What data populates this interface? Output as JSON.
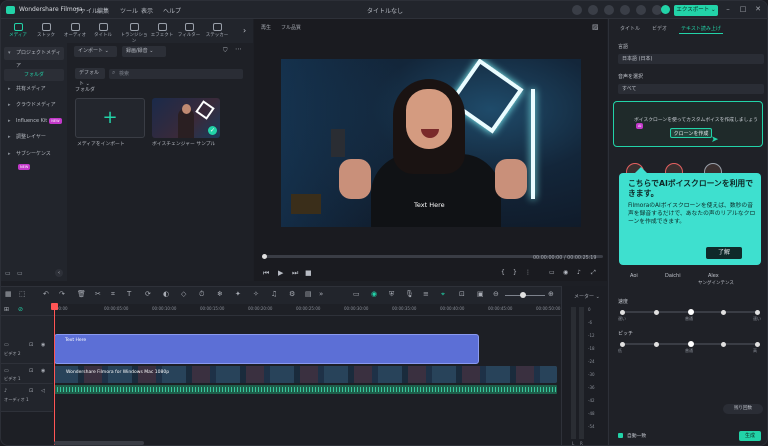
{
  "titlebar": {
    "app_name": "Wondershare Filmora",
    "menu": [
      "ファイル",
      "編集",
      "ツール",
      "表示",
      "ヘルプ"
    ],
    "document_title": "タイトルなし",
    "export_label": "エクスポート ⌄"
  },
  "media_toolbar": {
    "tabs": [
      "メディア",
      "ストック",
      "オーディオ",
      "タイトル",
      "トランジション",
      "エフェクト",
      "フィルター",
      "ステッカー"
    ],
    "active_tab": 0
  },
  "left_nav": {
    "items": [
      {
        "label": "プロジェクトメディア",
        "expanded": true
      },
      {
        "label": "フォルダ",
        "selected": true
      },
      {
        "label": "共有メディア"
      },
      {
        "label": "クラウドメディア"
      },
      {
        "label": "Influence Kit",
        "badge": "NEW"
      },
      {
        "label": "調整レイヤー"
      },
      {
        "label": "サブシーケンス",
        "badge": "NEW"
      }
    ]
  },
  "media": {
    "import_label": "インポート ⌄",
    "record_label": "録画/録音 ⌄",
    "sort_label": "デフォルト ⌄",
    "search_placeholder": "検索",
    "folder_label": "フォルダ",
    "import_card_label": "メディアをインポート",
    "sample_label": "ボイスチェンジャー サンプル"
  },
  "preview": {
    "player_label": "再生",
    "quality_label": "フル品質",
    "video_overlay_text": "Text Here",
    "current_time": "00:00:00:00",
    "total_time": "/ 00:00:25:19"
  },
  "right_panel": {
    "tabs": [
      "タイトル",
      "ビデオ",
      "テキスト読み上げ"
    ],
    "active_tab": 2,
    "language_label": "言語",
    "language_value": "日本語 (日本)",
    "voice_select_label": "音声を選択",
    "voice_filter": "すべて",
    "clone_prompt": "ボイスクローンを使ってカスタムボイスを作成しましょう",
    "clone_badge": "AI",
    "clone_button": "クローンを作成",
    "tooltip_title": "こちらでAIボイスクローンを利用できます。",
    "tooltip_body": "FilmoraのAIボイスクローンを使えば、数秒の音声を録音するだけで、あなたの声のリアルなクローンを作成できます。",
    "tooltip_ok": "了解",
    "voices": [
      {
        "name": "Aoi",
        "sub": ""
      },
      {
        "name": "Daichi",
        "sub": ""
      },
      {
        "name": "Alex",
        "sub": "ヤングインテンス"
      }
    ],
    "speed_label": "速度",
    "speed_ticks": [
      "遅い",
      "普通",
      "速い"
    ],
    "pitch_label": "ピッチ",
    "pitch_ticks": [
      "低",
      "普通",
      "高"
    ],
    "credits_label": "残り回数",
    "auto_label": "自動一致",
    "save_label": "生成"
  },
  "timeline": {
    "meter_label": "メーター ⌄",
    "ruler": [
      "00:00",
      "00:00:05:00",
      "00:00:10:00",
      "00:00:15:00",
      "00:00:20:00",
      "00:00:25:00",
      "00:00:30:00",
      "00:00:35:00",
      "00:00:40:00",
      "00:00:45:00",
      "00:00:50:00"
    ],
    "tracks": [
      {
        "name": "ビデオ 2"
      },
      {
        "name": "ビデオ 1"
      },
      {
        "name": "オーディオ 1"
      }
    ],
    "text_clip_label": "Text Here",
    "video_clip_label": "Wondershare Filmora for Windows Mac 1080p",
    "meter_ticks": [
      "0",
      "-6",
      "-12",
      "-18",
      "-24",
      "-30",
      "-36",
      "-42",
      "-48",
      "-54"
    ],
    "meter_lr": [
      "L",
      "R"
    ]
  },
  "colors": {
    "accent": "#22d3a8",
    "text_clip": "#5c6fd6",
    "tooltip": "#3ee0cf",
    "playhead": "#ff5555"
  }
}
